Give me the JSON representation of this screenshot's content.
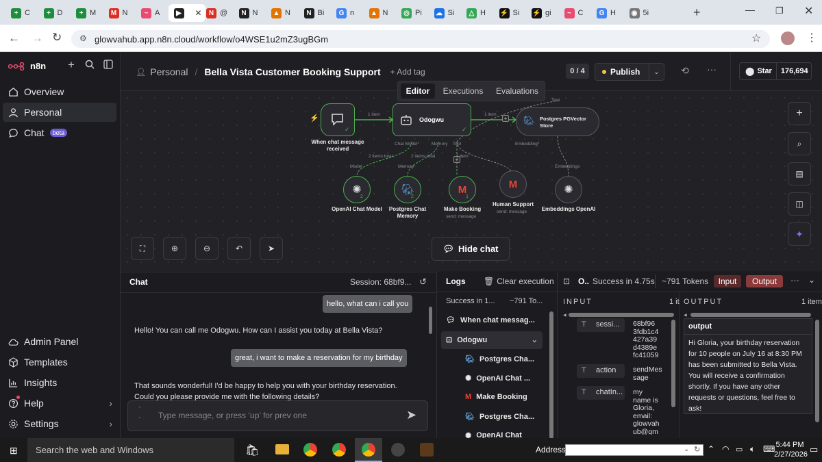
{
  "browser": {
    "tabs": [
      {
        "label": "C",
        "color": "#1e8e3e",
        "glyph": "+"
      },
      {
        "label": "D",
        "color": "#1e8e3e",
        "glyph": "+"
      },
      {
        "label": "M",
        "color": "#1e8e3e",
        "glyph": "+"
      },
      {
        "label": "N",
        "color": "#d93025",
        "glyph": "M"
      },
      {
        "label": "A",
        "color": "#ea4b71",
        "glyph": "~"
      },
      {
        "label": "",
        "color": "#222",
        "glyph": "▶",
        "active": true
      },
      {
        "label": "@",
        "color": "#d93025",
        "glyph": "N"
      },
      {
        "label": "N",
        "color": "#222",
        "glyph": "N"
      },
      {
        "label": "N",
        "color": "#e37400",
        "glyph": "▲"
      },
      {
        "label": "Bi",
        "color": "#222",
        "glyph": "N"
      },
      {
        "label": "n",
        "color": "#4285f4",
        "glyph": "G"
      },
      {
        "label": "N",
        "color": "#e37400",
        "glyph": "▲"
      },
      {
        "label": "Pi",
        "color": "#34a853",
        "glyph": "◎"
      },
      {
        "label": "Si",
        "color": "#1a73e8",
        "glyph": "☁"
      },
      {
        "label": "H",
        "color": "#34a853",
        "glyph": "△"
      },
      {
        "label": "Si",
        "color": "#111",
        "glyph": "⚡"
      },
      {
        "label": "gi",
        "color": "#111",
        "glyph": "⚡"
      },
      {
        "label": "C",
        "color": "#ea4b71",
        "glyph": "~"
      },
      {
        "label": "H",
        "color": "#4285f4",
        "glyph": "G"
      },
      {
        "label": "5i",
        "color": "#777",
        "glyph": "◉"
      }
    ],
    "url": "glowvahub.app.n8n.cloud/workflow/o4WSE1u2mZ3ugBGm"
  },
  "sidebar": {
    "brand": "n8n",
    "items": [
      {
        "label": "Overview",
        "icon": "home-icon"
      },
      {
        "label": "Personal",
        "icon": "user-icon"
      },
      {
        "label": "Chat",
        "icon": "chat-icon",
        "badge": "beta"
      }
    ],
    "bottom": [
      {
        "label": "Admin Panel",
        "icon": "cloud-icon"
      },
      {
        "label": "Templates",
        "icon": "box-icon"
      },
      {
        "label": "Insights",
        "icon": "chart-icon"
      },
      {
        "label": "Help",
        "icon": "help-icon"
      },
      {
        "label": "Settings",
        "icon": "gear-icon"
      }
    ]
  },
  "header": {
    "project": "Personal",
    "separator": "/",
    "workflow_name": "Bella Vista Customer Booking Support",
    "add_tag": "+ Add tag",
    "counter": "0 / 4",
    "publish": "Publish",
    "star": "Star",
    "stars_count": "176,694",
    "tabs": [
      "Editor",
      "Executions",
      "Evaluations"
    ]
  },
  "canvas": {
    "nodes": {
      "trigger": "When chat message received",
      "agent": "Odogwu",
      "vector": "Postgres PGVector Store",
      "openai": "OpenAI Chat Model",
      "memory": "Postgres Chat Memory",
      "booking": "Make Booking",
      "booking_sub": "send: message",
      "human": "Human Support",
      "human_sub": "send: message",
      "embeddings": "Embeddings OpenAI"
    },
    "edge_labels": {
      "item1": "1 item",
      "item2": "1 item",
      "chat_model": "Chat Model*",
      "memory": "Memory",
      "tool": "Tool",
      "tool_top": "Tool",
      "embedding": "Embedding*",
      "total1": "2 items total",
      "total2": "2 items total",
      "item3": "1 item",
      "model": "Model",
      "memory2": "Memory",
      "embeddings": "Embeddings"
    },
    "badges": {
      "openai": "2",
      "memory": "2",
      "booking": "1"
    },
    "hide_chat": "Hide chat"
  },
  "chat": {
    "title": "Chat",
    "session": "Session: 68bf9...",
    "messages": [
      {
        "role": "user",
        "text": "hello, what can i call you"
      },
      {
        "role": "bot",
        "text": "Hello! You can call me Odogwu. How can I assist you today at Bella Vista?"
      },
      {
        "role": "user",
        "text": "great, i want to make a reservation for my birthday"
      },
      {
        "role": "bot",
        "text": "That sounds wonderful! I'd be happy to help you with your birthday reservation. Could you please provide me with the following details?"
      }
    ],
    "placeholder": "Type message, or press ‘up’ for prev one"
  },
  "logs": {
    "title": "Logs",
    "clear": "Clear execution",
    "summary": "Success in 1...",
    "tokens": "~791 To...",
    "items": [
      {
        "label": "When chat messag...",
        "icon": "chat-icon",
        "level": 0
      },
      {
        "label": "Odogwu",
        "icon": "robot-icon",
        "level": 0,
        "selected": true
      },
      {
        "label": "Postgres Cha...",
        "icon": "postgres-icon",
        "level": 1
      },
      {
        "label": "OpenAI Chat ...",
        "icon": "openai-icon",
        "level": 1
      },
      {
        "label": "Make Booking",
        "icon": "gmail-icon",
        "level": 1
      },
      {
        "label": "Postgres Cha...",
        "icon": "postgres-icon",
        "level": 1
      },
      {
        "label": "OpenAI Chat",
        "icon": "openai-icon",
        "level": 1
      }
    ]
  },
  "io": {
    "node": "O..",
    "status": "Success in 4.75s",
    "tokens": "~791 Tokens",
    "input_btn": "Input",
    "output_btn": "Output",
    "input_title": "INPUT",
    "input_count": "1 it",
    "output_title": "OUTPUT",
    "output_count": "1 item",
    "fields": [
      {
        "key": "sessi...",
        "value": "68bf96\n3fdb1c4\n427a39\nd4389e\nfc41059"
      },
      {
        "key": "action",
        "value": "sendMes\nsage"
      },
      {
        "key": "chatIn...",
        "value": "my\nname is\nGloria,\nemail:\nglowvah\nub@gm"
      }
    ],
    "output_key": "output",
    "output_text": "Hi Gloria, your birthday reservation for 10 people on July 16 at 8:30 PM has been submitted to Bella Vista. You will receive a confirmation shortly. If you have any other requests or questions, feel free to ask!"
  },
  "taskbar": {
    "search": "Search the web and Windows",
    "address": "Address",
    "time": "5:44 PM",
    "date": "2/27/2026"
  },
  "colors": {
    "accent": "#ea4b71",
    "success": "#4caf50",
    "publish_dot": "#f5c542",
    "output_btn": "#8a3a3a"
  }
}
